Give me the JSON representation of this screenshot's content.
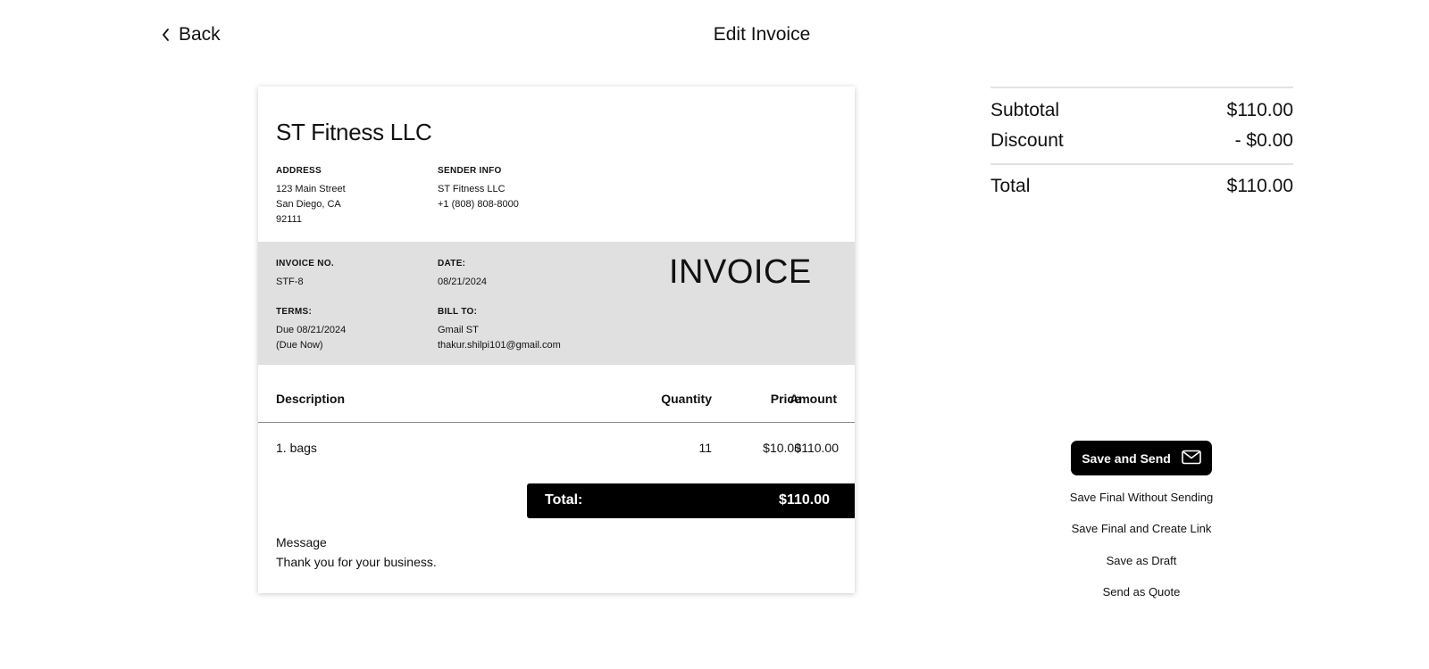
{
  "header": {
    "back_label": "Back",
    "title": "Edit Invoice"
  },
  "invoice": {
    "company": "ST Fitness LLC",
    "address_label": "ADDRESS",
    "address_lines": [
      "123 Main Street",
      "San Diego, CA",
      "92111"
    ],
    "sender_label": "SENDER INFO",
    "sender_lines": [
      "ST Fitness LLC",
      "+1 (808) 808-8000"
    ],
    "invoice_no_label": "INVOICE NO.",
    "invoice_no": "STF-8",
    "date_label": "DATE:",
    "date": "08/21/2024",
    "doc_title": "INVOICE",
    "terms_label": "TERMS:",
    "terms_lines": [
      "Due 08/21/2024",
      "(Due Now)"
    ],
    "bill_to_label": "BILL TO:",
    "bill_to_lines": [
      "Gmail ST",
      "thakur.shilpi101@gmail.com"
    ],
    "columns": {
      "description": "Description",
      "quantity": "Quantity",
      "price": "Price",
      "amount": "Amount"
    },
    "items": [
      {
        "description": "1. bags",
        "quantity": "11",
        "price": "$10.00",
        "amount": "$110.00"
      }
    ],
    "total_label": "Total:",
    "total_value": "$110.00",
    "message_label": "Message",
    "message_text": "Thank you for your business."
  },
  "summary": {
    "subtotal_label": "Subtotal",
    "subtotal_value": "$110.00",
    "discount_label": "Discount",
    "discount_value": "- $0.00",
    "total_label": "Total",
    "total_value": "$110.00"
  },
  "actions": {
    "save_send": "Save and Send",
    "save_final_no_send": "Save Final Without Sending",
    "save_final_link": "Save Final and Create Link",
    "save_draft": "Save as Draft",
    "send_quote": "Send as Quote"
  },
  "icons": {
    "back": "chevron-left-icon",
    "send": "envelope-icon"
  }
}
